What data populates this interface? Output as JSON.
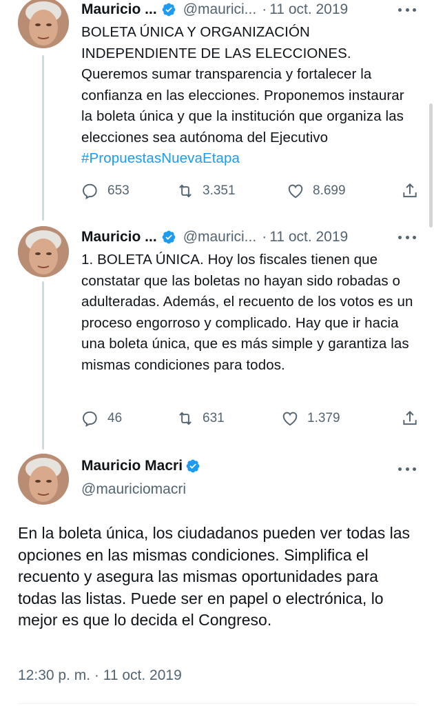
{
  "tweets": [
    {
      "name": "Mauricio ...",
      "handle": "@maurici...",
      "dot": "·",
      "date": "11 oct. 2019",
      "text_plain": "BOLETA ÚNICA Y ORGANIZACIÓN INDEPENDIENTE DE LAS ELECCIONES. Queremos sumar transparencia y fortalecer la confianza en las elecciones. Proponemos instaurar la boleta única y que la institución que organiza las elecciones sea autónoma del Ejecutivo ",
      "hashtag": "#PropuestasNuevaEtapa",
      "replies": "653",
      "retweets": "3.351",
      "likes": "8.699"
    },
    {
      "name": "Mauricio ...",
      "handle": "@maurici...",
      "dot": "·",
      "date": "11 oct. 2019",
      "text_plain": "1. BOLETA ÚNICA. Hoy los fiscales tienen que constatar que las boletas no hayan sido robadas o adulteradas. Además, el recuento de los votos es un proceso engorroso y complicado. Hay que ir hacia una boleta única, que es más simple y garantiza las mismas condiciones para todos.",
      "replies": "46",
      "retweets": "631",
      "likes": "1.379"
    }
  ],
  "focused": {
    "name": "Mauricio Macri",
    "handle": "@mauriciomacri",
    "text": "En la boleta única, los ciudadanos pueden ver todas las opciones en las mismas condiciones. Simplifica el recuento y asegura las mismas oportunidades para todas las listas. Puede ser en papel o electrónica, lo mejor es que lo decida el Congreso.",
    "timestamp": "12:30 p. m. · 11 oct. 2019"
  },
  "icons": [
    "verified-badge-icon",
    "more-icon",
    "reply-icon",
    "retweet-icon",
    "like-icon",
    "share-icon"
  ],
  "colors": {
    "accent": "#1d9bf0",
    "secondary_text": "#536471",
    "thread_line": "#cfd9de"
  }
}
